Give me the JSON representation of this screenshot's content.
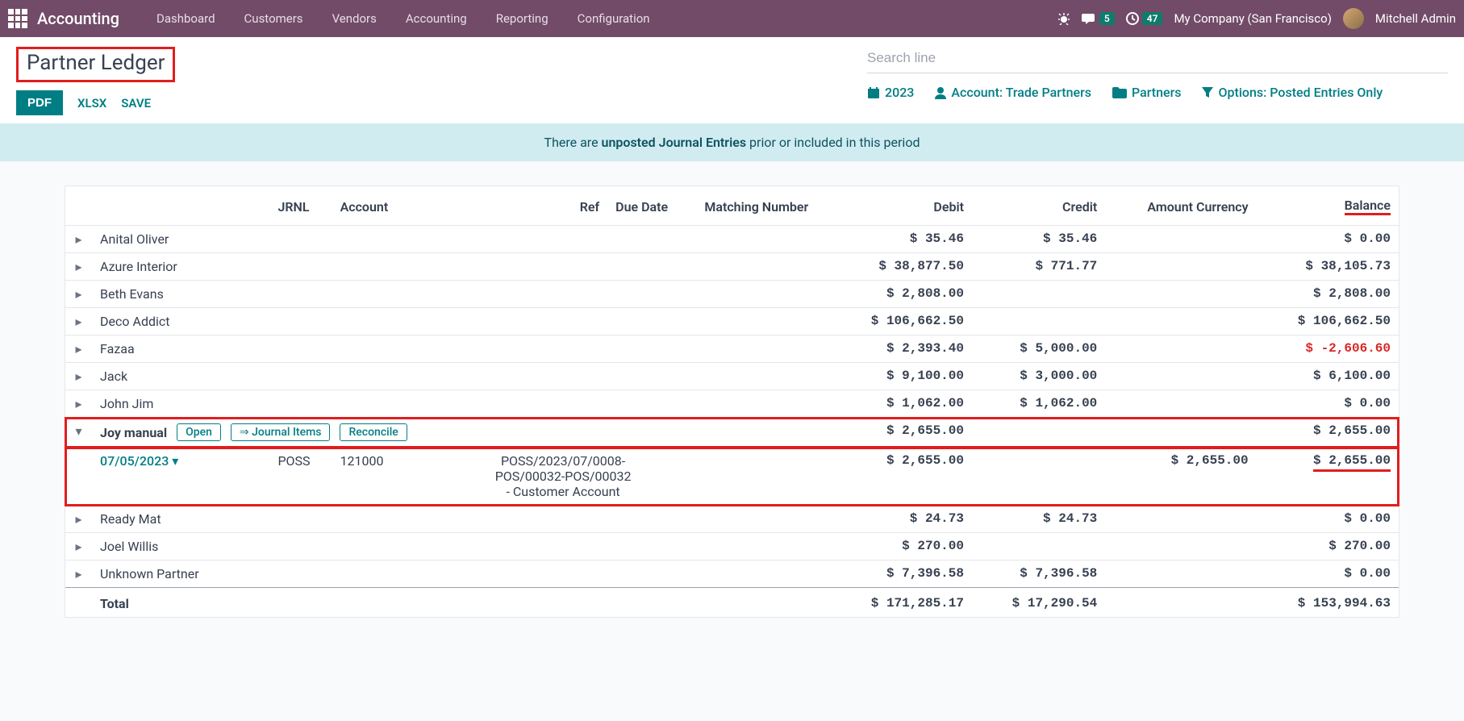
{
  "topnav": {
    "brand": "Accounting",
    "links": [
      "Dashboard",
      "Customers",
      "Vendors",
      "Accounting",
      "Reporting",
      "Configuration"
    ],
    "msg_count": "5",
    "activity_count": "47",
    "company": "My Company (San Francisco)",
    "user": "Mitchell Admin"
  },
  "header": {
    "title": "Partner Ledger",
    "pdf": "PDF",
    "xlsx": "XLSX",
    "save": "SAVE",
    "search_placeholder": "Search line",
    "year": "2023",
    "account_filter": "Account: Trade Partners",
    "partners_filter": "Partners",
    "options_filter": "Options: Posted Entries Only"
  },
  "banner": {
    "pre": "There are ",
    "bold": "unposted Journal Entries",
    "post": " prior or included in this period"
  },
  "columns": {
    "jrnl": "JRNL",
    "account": "Account",
    "ref": "Ref",
    "due": "Due Date",
    "match": "Matching Number",
    "debit": "Debit",
    "credit": "Credit",
    "amtcur": "Amount Currency",
    "balance": "Balance"
  },
  "rows": [
    {
      "name": "Anital Oliver",
      "debit": "$ 35.46",
      "credit": "$ 35.46",
      "balance": "$ 0.00"
    },
    {
      "name": "Azure Interior",
      "debit": "$ 38,877.50",
      "credit": "$ 771.77",
      "balance": "$ 38,105.73"
    },
    {
      "name": "Beth Evans",
      "debit": "$ 2,808.00",
      "credit": "",
      "balance": "$ 2,808.00"
    },
    {
      "name": "Deco Addict",
      "debit": "$ 106,662.50",
      "credit": "",
      "balance": "$ 106,662.50"
    },
    {
      "name": "Fazaa",
      "debit": "$ 2,393.40",
      "credit": "$ 5,000.00",
      "balance": "$ -2,606.60",
      "neg": true
    },
    {
      "name": "Jack",
      "debit": "$ 9,100.00",
      "credit": "$ 3,000.00",
      "balance": "$ 6,100.00"
    },
    {
      "name": "John Jim",
      "debit": "$ 1,062.00",
      "credit": "$ 1,062.00",
      "balance": "$ 0.00"
    }
  ],
  "expanded": {
    "name": "Joy manual",
    "pills": {
      "open": "Open",
      "journal": "⇒ Journal Items",
      "reconcile": "Reconcile"
    },
    "debit": "$ 2,655.00",
    "credit": "",
    "balance": "$ 2,655.00",
    "detail": {
      "date": "07/05/2023",
      "jrnl": "POSS",
      "account": "121000",
      "ref": "POSS/2023/07/0008-POS/00032-POS/00032 - Customer Account",
      "debit": "$ 2,655.00",
      "amtcur": "$ 2,655.00",
      "balance": "$ 2,655.00"
    }
  },
  "rows2": [
    {
      "name": "Ready Mat",
      "debit": "$ 24.73",
      "credit": "$ 24.73",
      "balance": "$ 0.00"
    },
    {
      "name": "Joel Willis",
      "debit": "$ 270.00",
      "credit": "",
      "balance": "$ 270.00"
    },
    {
      "name": "Unknown Partner",
      "debit": "$ 7,396.58",
      "credit": "$ 7,396.58",
      "balance": "$ 0.00"
    }
  ],
  "total": {
    "label": "Total",
    "debit": "$ 171,285.17",
    "credit": "$ 17,290.54",
    "balance": "$ 153,994.63"
  }
}
